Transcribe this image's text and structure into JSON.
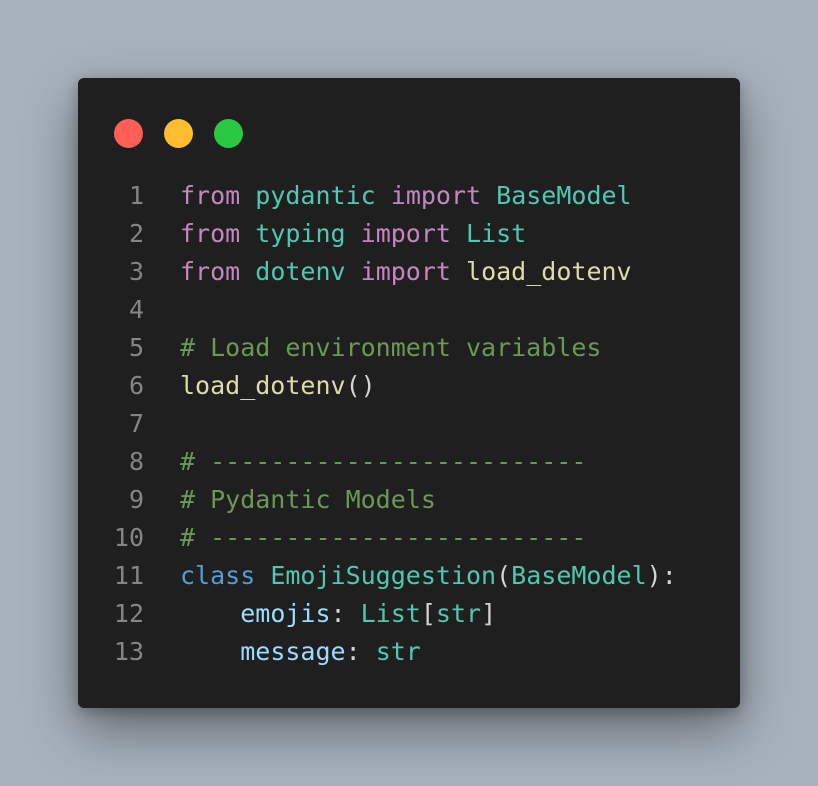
{
  "window": {
    "traffic_lights": [
      {
        "name": "close",
        "color": "#ff5f57"
      },
      {
        "name": "minimize",
        "color": "#febc2e"
      },
      {
        "name": "maximize",
        "color": "#28c840"
      }
    ]
  },
  "colors": {
    "background": "#a8b2bd",
    "editor_bg": "#1f1f1f",
    "line_number": "#858585",
    "keyword": "#c586c0",
    "keyword_def": "#569cd6",
    "type": "#4ec9b0",
    "function": "#dcdcaa",
    "comment": "#6a9955",
    "variable": "#9cdcfe",
    "plain": "#d4d4d4"
  },
  "code": {
    "lines": [
      {
        "n": "1",
        "tokens": [
          {
            "t": "from",
            "c": "kw"
          },
          {
            "t": " ",
            "c": "pl"
          },
          {
            "t": "pydantic",
            "c": "mod"
          },
          {
            "t": " ",
            "c": "pl"
          },
          {
            "t": "import",
            "c": "kw"
          },
          {
            "t": " ",
            "c": "pl"
          },
          {
            "t": "BaseModel",
            "c": "cls"
          }
        ]
      },
      {
        "n": "2",
        "tokens": [
          {
            "t": "from",
            "c": "kw"
          },
          {
            "t": " ",
            "c": "pl"
          },
          {
            "t": "typing",
            "c": "mod"
          },
          {
            "t": " ",
            "c": "pl"
          },
          {
            "t": "import",
            "c": "kw"
          },
          {
            "t": " ",
            "c": "pl"
          },
          {
            "t": "List",
            "c": "cls"
          }
        ]
      },
      {
        "n": "3",
        "tokens": [
          {
            "t": "from",
            "c": "kw"
          },
          {
            "t": " ",
            "c": "pl"
          },
          {
            "t": "dotenv",
            "c": "mod"
          },
          {
            "t": " ",
            "c": "pl"
          },
          {
            "t": "import",
            "c": "kw"
          },
          {
            "t": " ",
            "c": "pl"
          },
          {
            "t": "load_dotenv",
            "c": "fn"
          }
        ]
      },
      {
        "n": "4",
        "tokens": []
      },
      {
        "n": "5",
        "tokens": [
          {
            "t": "# Load environment variables",
            "c": "cm"
          }
        ]
      },
      {
        "n": "6",
        "tokens": [
          {
            "t": "load_dotenv",
            "c": "fn"
          },
          {
            "t": "()",
            "c": "pl"
          }
        ]
      },
      {
        "n": "7",
        "tokens": []
      },
      {
        "n": "8",
        "tokens": [
          {
            "t": "# -------------------------",
            "c": "cm"
          }
        ]
      },
      {
        "n": "9",
        "tokens": [
          {
            "t": "# Pydantic Models",
            "c": "cm"
          }
        ]
      },
      {
        "n": "10",
        "tokens": [
          {
            "t": "# -------------------------",
            "c": "cm"
          }
        ]
      },
      {
        "n": "11",
        "tokens": [
          {
            "t": "class",
            "c": "kw2"
          },
          {
            "t": " ",
            "c": "pl"
          },
          {
            "t": "EmojiSuggestion",
            "c": "cls"
          },
          {
            "t": "(",
            "c": "pl"
          },
          {
            "t": "BaseModel",
            "c": "cls"
          },
          {
            "t": "):",
            "c": "pl"
          }
        ]
      },
      {
        "n": "12",
        "tokens": [
          {
            "t": "    ",
            "c": "pl"
          },
          {
            "t": "emojis",
            "c": "var"
          },
          {
            "t": ": ",
            "c": "pl"
          },
          {
            "t": "List",
            "c": "cls"
          },
          {
            "t": "[",
            "c": "pl"
          },
          {
            "t": "str",
            "c": "cls"
          },
          {
            "t": "]",
            "c": "pl"
          }
        ]
      },
      {
        "n": "13",
        "tokens": [
          {
            "t": "    ",
            "c": "pl"
          },
          {
            "t": "message",
            "c": "var"
          },
          {
            "t": ": ",
            "c": "pl"
          },
          {
            "t": "str",
            "c": "cls"
          }
        ]
      }
    ]
  }
}
